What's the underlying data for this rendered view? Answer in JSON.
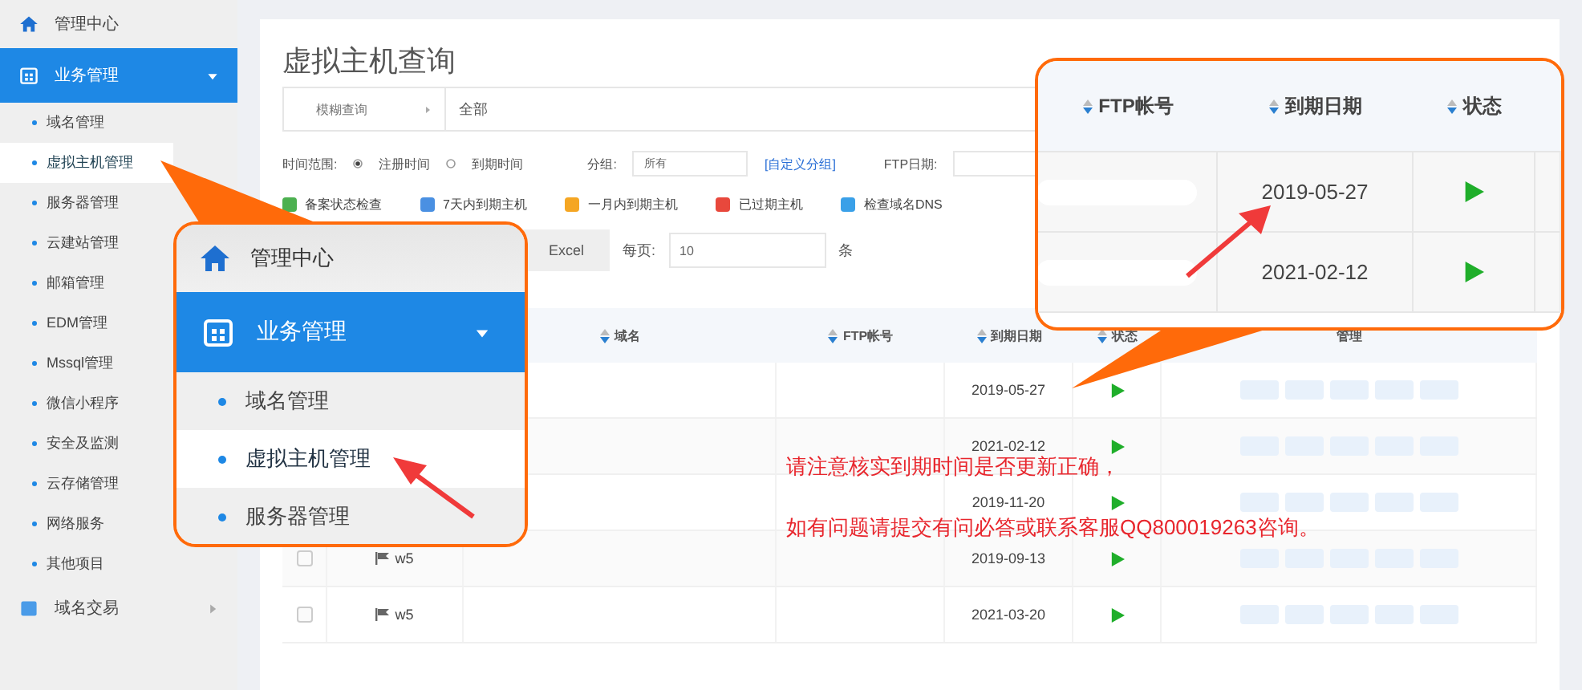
{
  "sidebar": {
    "items": [
      {
        "label": "管理中心",
        "kind": "home"
      },
      {
        "label": "业务管理",
        "kind": "group",
        "expanded": true,
        "children": [
          {
            "label": "域名管理",
            "selected": false
          },
          {
            "label": "虚拟主机管理",
            "selected": true
          },
          {
            "label": "服务器管理",
            "selected": false
          },
          {
            "label": "云建站管理",
            "selected": false
          },
          {
            "label": "邮箱管理",
            "selected": false
          },
          {
            "label": "EDM管理",
            "selected": false
          },
          {
            "label": "Mssql管理",
            "selected": false
          },
          {
            "label": "微信小程序",
            "selected": false
          },
          {
            "label": "安全及监测",
            "selected": false
          },
          {
            "label": "云存储管理",
            "selected": false
          },
          {
            "label": "网络服务",
            "selected": false
          },
          {
            "label": "其他项目",
            "selected": false
          }
        ]
      },
      {
        "label": "域名交易",
        "kind": "group",
        "expanded": false
      }
    ]
  },
  "page": {
    "title": "虚拟主机查询",
    "search_mode": "模糊查询",
    "search_scope": "全部",
    "time_label": "时间范围:",
    "time_options": [
      {
        "label": "注册时间",
        "selected": true
      },
      {
        "label": "到期时间",
        "selected": false
      }
    ],
    "group_label": "分组:",
    "group_value": "所有",
    "group_link": "[自定义分组]",
    "ftp_date_label": "FTP日期:",
    "legend": [
      {
        "label": "备案状态检查",
        "color": "#4cb050"
      },
      {
        "label": "7天内到期主机",
        "color": "#4a90e2"
      },
      {
        "label": "一月内到期主机",
        "color": "#f5a623"
      },
      {
        "label": "已过期主机",
        "color": "#e8483c"
      },
      {
        "label": "检查域名DNS",
        "color": "#3aa0e8"
      }
    ],
    "export_button": "Excel",
    "per_page_label": "每页:",
    "per_page": "10",
    "per_page_unit": "条"
  },
  "table": {
    "columns": [
      {
        "label": "域名",
        "sortable": true
      },
      {
        "label": "FTP帐号",
        "sortable": true
      },
      {
        "label": "到期日期",
        "sortable": true
      },
      {
        "label": "状态",
        "sortable": true
      },
      {
        "label": "管理",
        "sortable": false
      }
    ],
    "rows": [
      {
        "date": "2019-05-27",
        "running": true
      },
      {
        "date": "2021-02-12",
        "running": true
      },
      {
        "date": "2019-11-20",
        "running": true
      },
      {
        "checked": false,
        "name": "w5",
        "date": "2019-09-13",
        "running": true
      },
      {
        "checked": false,
        "name": "w5",
        "date": "2021-03-20",
        "running": true
      }
    ]
  },
  "zoom_sidebar": {
    "home": "管理中心",
    "group": "业务管理",
    "expanded": true,
    "items": [
      {
        "label": "域名管理",
        "selected": false
      },
      {
        "label": "虚拟主机管理",
        "selected": true
      },
      {
        "label": "服务器管理",
        "selected": false
      }
    ]
  },
  "zoom_table": {
    "columns": [
      "FTP帐号",
      "到期日期",
      "状态"
    ],
    "rows": [
      {
        "date": "2019-05-27",
        "running": true
      },
      {
        "date": "2021-02-12",
        "running": true
      }
    ]
  },
  "notice": [
    "请注意核实到期时间是否更新正确，",
    "如有问题请提交有问必答或联系客服QQ800019263咨询。"
  ]
}
